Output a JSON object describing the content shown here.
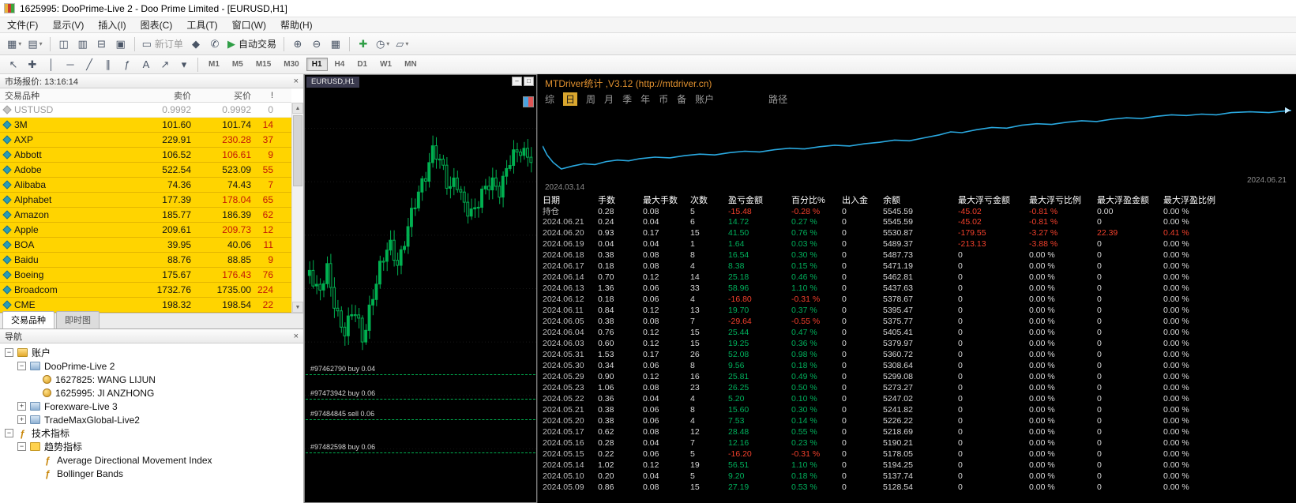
{
  "window": {
    "title": "1625995: DooPrime-Live 2 - Doo Prime Limited - [EURUSD,H1]"
  },
  "menu": [
    "文件(F)",
    "显示(V)",
    "插入(I)",
    "图表(C)",
    "工具(T)",
    "窗口(W)",
    "帮助(H)"
  ],
  "colors": {
    "accent_orange": "#e0902f",
    "green": "#00b05c",
    "red": "#f2402c",
    "equity_line": "#2aa9e0",
    "candle": "#00b050",
    "mw_yellow": "#ffd400"
  },
  "toolbar1": [
    {
      "t": "icon",
      "n": "new-chart-icon",
      "g": "▦",
      "caret": true
    },
    {
      "t": "icon",
      "n": "profiles-icon",
      "g": "▤",
      "caret": true
    },
    {
      "t": "sep"
    },
    {
      "t": "icon",
      "n": "market-watch-toggle-icon",
      "g": "◫"
    },
    {
      "t": "icon",
      "n": "data-window-icon",
      "g": "▥"
    },
    {
      "t": "icon",
      "n": "navigator-toggle-icon",
      "g": "⊟"
    },
    {
      "t": "icon",
      "n": "terminal-toggle-icon",
      "g": "▣"
    },
    {
      "t": "sep"
    },
    {
      "t": "button",
      "n": "new-order-button",
      "g": "▭",
      "label": "新订单",
      "disabled": true
    },
    {
      "t": "icon",
      "n": "metaeditor-icon",
      "g": "◆"
    },
    {
      "t": "icon",
      "n": "expert-advisors-icon",
      "g": "✆"
    },
    {
      "t": "button",
      "n": "autotrading-button",
      "g": "▶",
      "label": "自动交易",
      "green": true
    },
    {
      "t": "sep"
    },
    {
      "t": "icon",
      "n": "zoom-in-icon",
      "g": "⊕"
    },
    {
      "t": "icon",
      "n": "zoom-out-icon",
      "g": "⊖"
    },
    {
      "t": "icon",
      "n": "tile-windows-icon",
      "g": "▦"
    },
    {
      "t": "sep"
    },
    {
      "t": "icon",
      "n": "indicators-add-icon",
      "g": "✚",
      "green": true
    },
    {
      "t": "icon",
      "n": "periods-icon",
      "g": "◷",
      "caret": true
    },
    {
      "t": "icon",
      "n": "templates-icon",
      "g": "▱",
      "caret": true
    }
  ],
  "toolbar2": {
    "tools": [
      {
        "n": "cursor-icon",
        "g": "↖"
      },
      {
        "n": "crosshair-icon",
        "g": "✚"
      },
      {
        "n": "vertical-line-icon",
        "g": "│"
      },
      {
        "n": "horizontal-line-icon",
        "g": "─"
      },
      {
        "n": "trendline-icon",
        "g": "╱"
      },
      {
        "n": "channel-icon",
        "g": "∥"
      },
      {
        "n": "fibonacci-icon",
        "g": "ƒ"
      },
      {
        "n": "text-label-icon",
        "g": "A"
      },
      {
        "n": "arrow-tool-icon",
        "g": "↗"
      },
      {
        "n": "shapes-dropdown-icon",
        "g": "▾"
      }
    ],
    "timeframes": [
      "M1",
      "M5",
      "M15",
      "M30",
      "H1",
      "H4",
      "D1",
      "W1",
      "MN"
    ],
    "active_timeframe": "H1"
  },
  "market_watch": {
    "title": "市场报价: 13:16:14",
    "columns": [
      "交易品种",
      "卖价",
      "买价",
      "!"
    ],
    "rows": [
      {
        "symbol": "USTUSD",
        "bid": "0.9992",
        "ask": "0.9992",
        "spread": "0",
        "muted": true
      },
      {
        "symbol": "3M",
        "bid": "101.60",
        "ask": "101.74",
        "spread": "14"
      },
      {
        "symbol": "AXP",
        "bid": "229.91",
        "ask": "230.28",
        "spread": "37",
        "ask_red": true
      },
      {
        "symbol": "Abbott",
        "bid": "106.52",
        "ask": "106.61",
        "spread": "9",
        "ask_red": true
      },
      {
        "symbol": "Adobe",
        "bid": "522.54",
        "ask": "523.09",
        "spread": "55"
      },
      {
        "symbol": "Alibaba",
        "bid": "74.36",
        "ask": "74.43",
        "spread": "7"
      },
      {
        "symbol": "Alphabet",
        "bid": "177.39",
        "ask": "178.04",
        "spread": "65",
        "ask_red": true
      },
      {
        "symbol": "Amazon",
        "bid": "185.77",
        "ask": "186.39",
        "spread": "62"
      },
      {
        "symbol": "Apple",
        "bid": "209.61",
        "ask": "209.73",
        "spread": "12",
        "ask_red": true
      },
      {
        "symbol": "BOA",
        "bid": "39.95",
        "ask": "40.06",
        "spread": "11"
      },
      {
        "symbol": "Baidu",
        "bid": "88.76",
        "ask": "88.85",
        "spread": "9"
      },
      {
        "symbol": "Boeing",
        "bid": "175.67",
        "ask": "176.43",
        "spread": "76",
        "ask_red": true
      },
      {
        "symbol": "Broadcom",
        "bid": "1732.76",
        "ask": "1735.00",
        "spread": "224"
      },
      {
        "symbol": "CME",
        "bid": "198.32",
        "ask": "198.54",
        "spread": "22"
      }
    ],
    "tabs": [
      "交易品种",
      "即时图"
    ],
    "active_tab": "交易品种"
  },
  "navigator": {
    "title": "导航",
    "items": [
      {
        "depth": 0,
        "expander": "minus",
        "icon": "accounts",
        "label": "账户"
      },
      {
        "depth": 1,
        "expander": "minus",
        "icon": "server",
        "label": "DooPrime-Live 2"
      },
      {
        "depth": 2,
        "expander": "none",
        "icon": "account",
        "label": "1627825: WANG LIJUN"
      },
      {
        "depth": 2,
        "expander": "none",
        "icon": "account",
        "label": "1625995: JI ANZHONG"
      },
      {
        "depth": 1,
        "expander": "plus",
        "icon": "server",
        "label": "Forexware-Live 3"
      },
      {
        "depth": 1,
        "expander": "plus",
        "icon": "server",
        "label": "TradeMaxGlobal-Live2"
      },
      {
        "depth": 0,
        "expander": "minus",
        "icon": "function",
        "label": "技术指标"
      },
      {
        "depth": 1,
        "expander": "minus",
        "icon": "folder",
        "label": "趋势指标"
      },
      {
        "depth": 2,
        "expander": "none",
        "icon": "function",
        "label": "Average Directional Movement Index"
      },
      {
        "depth": 2,
        "expander": "none",
        "icon": "function",
        "label": "Bollinger Bands"
      }
    ]
  },
  "chart": {
    "symbol_label": "EURUSD,H1",
    "candle_count": 64,
    "price_path": [
      [
        0,
        0.45
      ],
      [
        0.04,
        0.52
      ],
      [
        0.08,
        0.46
      ],
      [
        0.12,
        0.55
      ],
      [
        0.16,
        0.6
      ],
      [
        0.2,
        0.55
      ],
      [
        0.24,
        0.62
      ],
      [
        0.28,
        0.52
      ],
      [
        0.32,
        0.45
      ],
      [
        0.36,
        0.4
      ],
      [
        0.4,
        0.44
      ],
      [
        0.44,
        0.36
      ],
      [
        0.48,
        0.3
      ],
      [
        0.52,
        0.24
      ],
      [
        0.56,
        0.16
      ],
      [
        0.6,
        0.22
      ],
      [
        0.63,
        0.28
      ],
      [
        0.66,
        0.24
      ],
      [
        0.7,
        0.3
      ],
      [
        0.74,
        0.33
      ],
      [
        0.78,
        0.28
      ],
      [
        0.82,
        0.24
      ],
      [
        0.86,
        0.27
      ],
      [
        0.9,
        0.21
      ],
      [
        0.95,
        0.17
      ],
      [
        1,
        0.19
      ]
    ],
    "orders": [
      {
        "label": "#97462790 buy 0.04",
        "y": 0.7
      },
      {
        "label": "#97473942 buy 0.06",
        "y": 0.757
      },
      {
        "label": "#97484845 sell 0.06",
        "y": 0.806
      },
      {
        "label": "#97482598 buy 0.06",
        "y": 0.884
      }
    ]
  },
  "stats": {
    "title": "MTDriver统计 ,V3.12 (http://mtdriver.cn)",
    "tabs": [
      "综",
      "日",
      "周",
      "月",
      "季",
      "年",
      "币",
      "备",
      "账户"
    ],
    "active_tab": "日",
    "path_tab": "路径",
    "date_start": "2024.03.14",
    "date_end": "2024.06.21",
    "equity_points": [
      [
        0.0,
        0.52
      ],
      [
        0.006,
        0.64
      ],
      [
        0.014,
        0.74
      ],
      [
        0.025,
        0.83
      ],
      [
        0.04,
        0.79
      ],
      [
        0.055,
        0.76
      ],
      [
        0.07,
        0.77
      ],
      [
        0.085,
        0.73
      ],
      [
        0.1,
        0.71
      ],
      [
        0.115,
        0.72
      ],
      [
        0.13,
        0.69
      ],
      [
        0.15,
        0.67
      ],
      [
        0.17,
        0.68
      ],
      [
        0.19,
        0.65
      ],
      [
        0.21,
        0.63
      ],
      [
        0.23,
        0.64
      ],
      [
        0.25,
        0.61
      ],
      [
        0.27,
        0.59
      ],
      [
        0.29,
        0.6
      ],
      [
        0.31,
        0.57
      ],
      [
        0.33,
        0.55
      ],
      [
        0.35,
        0.56
      ],
      [
        0.37,
        0.53
      ],
      [
        0.39,
        0.51
      ],
      [
        0.41,
        0.52
      ],
      [
        0.43,
        0.49
      ],
      [
        0.45,
        0.47
      ],
      [
        0.47,
        0.44
      ],
      [
        0.49,
        0.45
      ],
      [
        0.51,
        0.41
      ],
      [
        0.53,
        0.37
      ],
      [
        0.545,
        0.33
      ],
      [
        0.56,
        0.34
      ],
      [
        0.58,
        0.3
      ],
      [
        0.6,
        0.27
      ],
      [
        0.62,
        0.28
      ],
      [
        0.64,
        0.24
      ],
      [
        0.66,
        0.22
      ],
      [
        0.68,
        0.23
      ],
      [
        0.7,
        0.2
      ],
      [
        0.72,
        0.18
      ],
      [
        0.74,
        0.19
      ],
      [
        0.76,
        0.16
      ],
      [
        0.78,
        0.14
      ],
      [
        0.8,
        0.15
      ],
      [
        0.82,
        0.12
      ],
      [
        0.84,
        0.1
      ],
      [
        0.86,
        0.11
      ],
      [
        0.88,
        0.09
      ],
      [
        0.9,
        0.1
      ],
      [
        0.92,
        0.07
      ],
      [
        0.945,
        0.06
      ],
      [
        0.97,
        0.07
      ],
      [
        1.0,
        0.04
      ]
    ],
    "table": {
      "columns": [
        "日期",
        "手数",
        "最大手数",
        "次数",
        "盈亏金额",
        "百分比%",
        "出入金",
        "余额",
        "最大浮亏金额",
        "最大浮亏比例",
        "最大浮盈金额",
        "最大浮盈比例"
      ],
      "rows": [
        [
          "持仓",
          "0.28",
          "0.08",
          "5",
          "-15.48",
          "-0.28 %",
          "0",
          "5545.59",
          "-45.02",
          "-0.81 %",
          "0.00",
          "0.00 %"
        ],
        [
          "2024.06.21",
          "0.24",
          "0.04",
          "6",
          "14.72",
          "0.27 %",
          "0",
          "5545.59",
          "-45.02",
          "-0.81 %",
          "0",
          "0.00 %"
        ],
        [
          "2024.06.20",
          "0.93",
          "0.17",
          "15",
          "41.50",
          "0.76 %",
          "0",
          "5530.87",
          "-179.55",
          "-3.27 %",
          "22.39",
          "0.41 %"
        ],
        [
          "2024.06.19",
          "0.04",
          "0.04",
          "1",
          "1.64",
          "0.03 %",
          "0",
          "5489.37",
          "-213.13",
          "-3.88 %",
          "0",
          "0.00 %"
        ],
        [
          "2024.06.18",
          "0.38",
          "0.08",
          "8",
          "16.54",
          "0.30 %",
          "0",
          "5487.73",
          "0",
          "0.00 %",
          "0",
          "0.00 %"
        ],
        [
          "2024.06.17",
          "0.18",
          "0.08",
          "4",
          "8.38",
          "0.15 %",
          "0",
          "5471.19",
          "0",
          "0.00 %",
          "0",
          "0.00 %"
        ],
        [
          "2024.06.14",
          "0.70",
          "0.12",
          "14",
          "25.18",
          "0.46 %",
          "0",
          "5462.81",
          "0",
          "0.00 %",
          "0",
          "0.00 %"
        ],
        [
          "2024.06.13",
          "1.36",
          "0.06",
          "33",
          "58.96",
          "1.10 %",
          "0",
          "5437.63",
          "0",
          "0.00 %",
          "0",
          "0.00 %"
        ],
        [
          "2024.06.12",
          "0.18",
          "0.06",
          "4",
          "-16.80",
          "-0.31 %",
          "0",
          "5378.67",
          "0",
          "0.00 %",
          "0",
          "0.00 %"
        ],
        [
          "2024.06.11",
          "0.84",
          "0.12",
          "13",
          "19.70",
          "0.37 %",
          "0",
          "5395.47",
          "0",
          "0.00 %",
          "0",
          "0.00 %"
        ],
        [
          "2024.06.05",
          "0.38",
          "0.08",
          "7",
          "-29.64",
          "-0.55 %",
          "0",
          "5375.77",
          "0",
          "0.00 %",
          "0",
          "0.00 %"
        ],
        [
          "2024.06.04",
          "0.76",
          "0.12",
          "15",
          "25.44",
          "0.47 %",
          "0",
          "5405.41",
          "0",
          "0.00 %",
          "0",
          "0.00 %"
        ],
        [
          "2024.06.03",
          "0.60",
          "0.12",
          "15",
          "19.25",
          "0.36 %",
          "0",
          "5379.97",
          "0",
          "0.00 %",
          "0",
          "0.00 %"
        ],
        [
          "2024.05.31",
          "1.53",
          "0.17",
          "26",
          "52.08",
          "0.98 %",
          "0",
          "5360.72",
          "0",
          "0.00 %",
          "0",
          "0.00 %"
        ],
        [
          "2024.05.30",
          "0.34",
          "0.06",
          "8",
          "9.56",
          "0.18 %",
          "0",
          "5308.64",
          "0",
          "0.00 %",
          "0",
          "0.00 %"
        ],
        [
          "2024.05.29",
          "0.90",
          "0.12",
          "16",
          "25.81",
          "0.49 %",
          "0",
          "5299.08",
          "0",
          "0.00 %",
          "0",
          "0.00 %"
        ],
        [
          "2024.05.23",
          "1.06",
          "0.08",
          "23",
          "26.25",
          "0.50 %",
          "0",
          "5273.27",
          "0",
          "0.00 %",
          "0",
          "0.00 %"
        ],
        [
          "2024.05.22",
          "0.36",
          "0.04",
          "4",
          "5.20",
          "0.10 %",
          "0",
          "5247.02",
          "0",
          "0.00 %",
          "0",
          "0.00 %"
        ],
        [
          "2024.05.21",
          "0.38",
          "0.06",
          "8",
          "15.60",
          "0.30 %",
          "0",
          "5241.82",
          "0",
          "0.00 %",
          "0",
          "0.00 %"
        ],
        [
          "2024.05.20",
          "0.38",
          "0.06",
          "4",
          "7.53",
          "0.14 %",
          "0",
          "5226.22",
          "0",
          "0.00 %",
          "0",
          "0.00 %"
        ],
        [
          "2024.05.17",
          "0.62",
          "0.08",
          "12",
          "28.48",
          "0.55 %",
          "0",
          "5218.69",
          "0",
          "0.00 %",
          "0",
          "0.00 %"
        ],
        [
          "2024.05.16",
          "0.28",
          "0.04",
          "7",
          "12.16",
          "0.23 %",
          "0",
          "5190.21",
          "0",
          "0.00 %",
          "0",
          "0.00 %"
        ],
        [
          "2024.05.15",
          "0.22",
          "0.06",
          "5",
          "-16.20",
          "-0.31 %",
          "0",
          "5178.05",
          "0",
          "0.00 %",
          "0",
          "0.00 %"
        ],
        [
          "2024.05.14",
          "1.02",
          "0.12",
          "19",
          "56.51",
          "1.10 %",
          "0",
          "5194.25",
          "0",
          "0.00 %",
          "0",
          "0.00 %"
        ],
        [
          "2024.05.10",
          "0.20",
          "0.04",
          "5",
          "9.20",
          "0.18 %",
          "0",
          "5137.74",
          "0",
          "0.00 %",
          "0",
          "0.00 %"
        ],
        [
          "2024.05.09",
          "0.86",
          "0.08",
          "15",
          "27.19",
          "0.53 %",
          "0",
          "5128.54",
          "0",
          "0.00 %",
          "0",
          "0.00 %"
        ]
      ]
    }
  }
}
